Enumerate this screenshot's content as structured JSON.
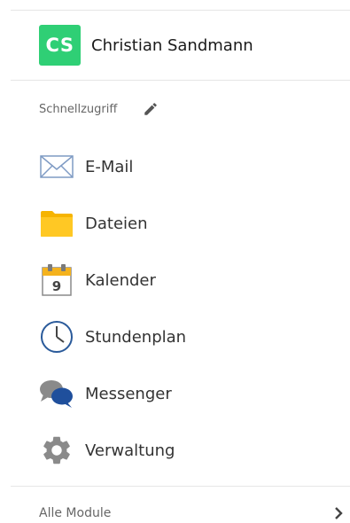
{
  "user": {
    "avatar_initials": "CS",
    "avatar_color": "#2fcf75",
    "name": "Christian Sandmann"
  },
  "quick_access": {
    "header_label": "Schnellzugriff",
    "edit_icon": "pencil-icon",
    "items": [
      {
        "label": "E-Mail",
        "icon": "envelope-icon"
      },
      {
        "label": "Dateien",
        "icon": "folder-icon",
        "color": "#ffc107"
      },
      {
        "label": "Kalender",
        "icon": "calendar-icon",
        "day": "9"
      },
      {
        "label": "Stundenplan",
        "icon": "clock-icon",
        "color": "#2a5a9a"
      },
      {
        "label": "Messenger",
        "icon": "chat-bubbles-icon"
      },
      {
        "label": "Verwaltung",
        "icon": "gear-icon"
      }
    ]
  },
  "footer": {
    "all_modules_label": "Alle Module",
    "icon": "chevron-right-icon"
  }
}
